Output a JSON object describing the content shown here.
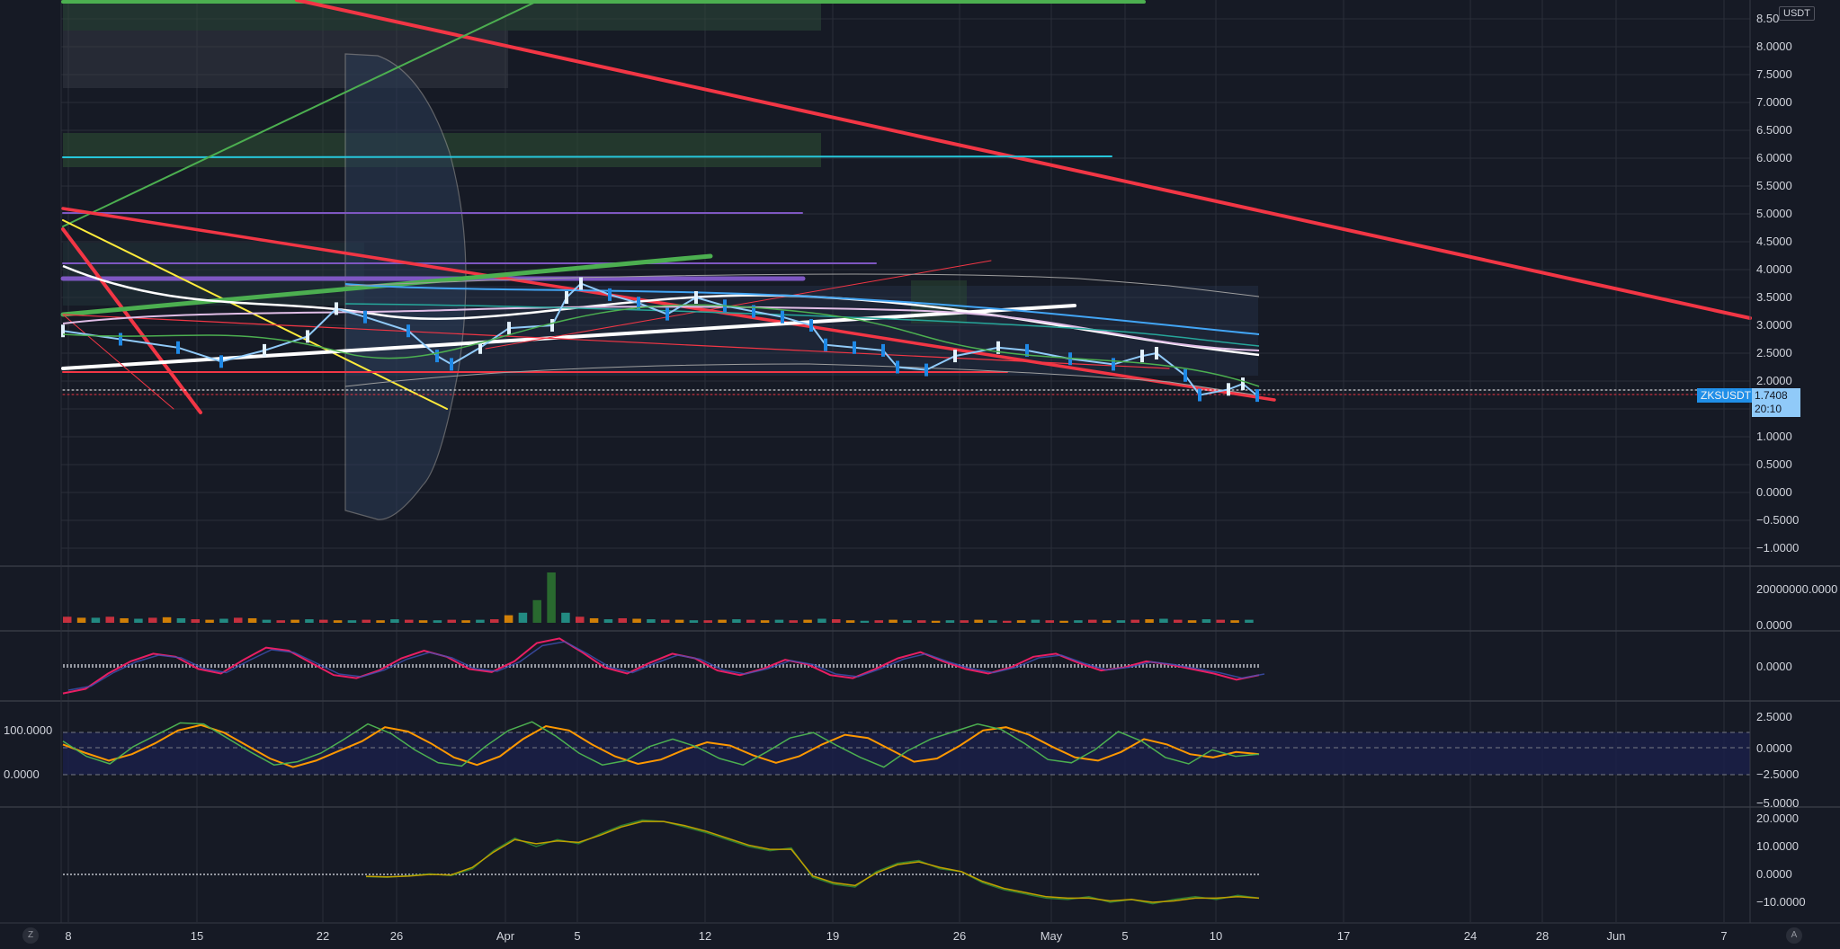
{
  "chart_data": {
    "type": "line",
    "symbol": "ZKSUSDT",
    "currency": "USDT",
    "last_price": "1.7408",
    "countdown": "20:10",
    "x_tick_labels": [
      "8",
      "15",
      "22",
      "26",
      "Apr",
      "5",
      "12",
      "19",
      "26",
      "May",
      "5",
      "10",
      "17",
      "24",
      "28",
      "Jun",
      "7"
    ],
    "price_axis": {
      "ticks": [
        "8.50",
        "8.0000",
        "7.5000",
        "7.0000",
        "6.5000",
        "6.0000",
        "5.5000",
        "5.0000",
        "4.5000",
        "4.0000",
        "3.5000",
        "3.0000",
        "2.5000",
        "2.0000",
        "1.5000",
        "1.0000",
        "0.5000",
        "0.0000",
        "−0.5000",
        "−1.0000"
      ],
      "ylim": [
        -1.0,
        8.5
      ]
    },
    "volume_axis": {
      "ticks": [
        "20000000.0000",
        "0.0000"
      ]
    },
    "oscillator1_axis": {
      "ticks": [
        "0.0000"
      ]
    },
    "oscillator2_axis": {
      "left_ticks": [
        "100.0000",
        "0.0000"
      ],
      "right_ticks": [
        "2.5000",
        "0.0000",
        "−2.5000",
        "−5.0000"
      ]
    },
    "oscillator3_axis": {
      "ticks": [
        "20.0000",
        "10.0000",
        "0.0000",
        "−10.0000"
      ]
    },
    "price_series": [
      {
        "x": 0,
        "y": 2.9
      },
      {
        "x": 4,
        "y": 2.75
      },
      {
        "x": 8,
        "y": 2.6
      },
      {
        "x": 11,
        "y": 2.35
      },
      {
        "x": 14,
        "y": 2.55
      },
      {
        "x": 17,
        "y": 2.8
      },
      {
        "x": 19,
        "y": 3.3
      },
      {
        "x": 21,
        "y": 3.15
      },
      {
        "x": 24,
        "y": 2.9
      },
      {
        "x": 26,
        "y": 2.45
      },
      {
        "x": 27,
        "y": 2.3
      },
      {
        "x": 29,
        "y": 2.6
      },
      {
        "x": 31,
        "y": 2.95
      },
      {
        "x": 34,
        "y": 3.0
      },
      {
        "x": 35,
        "y": 3.5
      },
      {
        "x": 36,
        "y": 3.75
      },
      {
        "x": 38,
        "y": 3.55
      },
      {
        "x": 40,
        "y": 3.4
      },
      {
        "x": 42,
        "y": 3.2
      },
      {
        "x": 44,
        "y": 3.5
      },
      {
        "x": 46,
        "y": 3.35
      },
      {
        "x": 48,
        "y": 3.25
      },
      {
        "x": 50,
        "y": 3.15
      },
      {
        "x": 52,
        "y": 3.0
      },
      {
        "x": 53,
        "y": 2.65
      },
      {
        "x": 55,
        "y": 2.6
      },
      {
        "x": 57,
        "y": 2.55
      },
      {
        "x": 58,
        "y": 2.25
      },
      {
        "x": 60,
        "y": 2.2
      },
      {
        "x": 62,
        "y": 2.45
      },
      {
        "x": 65,
        "y": 2.6
      },
      {
        "x": 67,
        "y": 2.55
      },
      {
        "x": 70,
        "y": 2.4
      },
      {
        "x": 73,
        "y": 2.3
      },
      {
        "x": 75,
        "y": 2.45
      },
      {
        "x": 76,
        "y": 2.5
      },
      {
        "x": 78,
        "y": 2.1
      },
      {
        "x": 79,
        "y": 1.75
      },
      {
        "x": 81,
        "y": 1.85
      },
      {
        "x": 82,
        "y": 1.95
      },
      {
        "x": 83,
        "y": 1.74
      }
    ],
    "volume_series": [
      0.12,
      0.1,
      0.1,
      0.12,
      0.09,
      0.08,
      0.1,
      0.11,
      0.09,
      0.07,
      0.06,
      0.08,
      0.1,
      0.09,
      0.06,
      0.05,
      0.06,
      0.07,
      0.06,
      0.05,
      0.05,
      0.06,
      0.05,
      0.07,
      0.06,
      0.05,
      0.05,
      0.06,
      0.05,
      0.06,
      0.07,
      0.15,
      0.2,
      0.45,
      1.0,
      0.2,
      0.12,
      0.09,
      0.07,
      0.09,
      0.08,
      0.07,
      0.06,
      0.06,
      0.05,
      0.05,
      0.06,
      0.07,
      0.06,
      0.05,
      0.06,
      0.05,
      0.06,
      0.08,
      0.07,
      0.05,
      0.04,
      0.05,
      0.06,
      0.05,
      0.05,
      0.04,
      0.05,
      0.05,
      0.06,
      0.05,
      0.04,
      0.05,
      0.06,
      0.05,
      0.04,
      0.05,
      0.06,
      0.05,
      0.05,
      0.06,
      0.07,
      0.08,
      0.06,
      0.05,
      0.07,
      0.06,
      0.05,
      0.06
    ],
    "series": [
      {
        "name": "",
        "color": "#e91e63",
        "values": [
          -1.8,
          -1.5,
          -0.5,
          0.3,
          0.8,
          0.6,
          -0.2,
          -0.5,
          0.4,
          1.2,
          1.0,
          0.2,
          -0.6,
          -0.8,
          -0.3,
          0.5,
          1.0,
          0.6,
          -0.2,
          -0.4,
          0.3,
          1.5,
          1.8,
          0.9,
          -0.1,
          -0.5,
          0.2,
          0.8,
          0.5,
          -0.3,
          -0.6,
          -0.2,
          0.4,
          0.1,
          -0.6,
          -0.8,
          -0.2,
          0.5,
          0.9,
          0.3,
          -0.2,
          -0.5,
          -0.1,
          0.6,
          0.8,
          0.2,
          -0.3,
          -0.1,
          0.3,
          0.1,
          -0.2,
          -0.5,
          -0.9,
          -0.6
        ]
      }
    ],
    "oscillator2_series": [
      {
        "name": "",
        "color": "#ff9800",
        "values": [
          0.3,
          -0.5,
          -1.2,
          -0.6,
          0.4,
          1.6,
          2.1,
          1.4,
          0.2,
          -1.0,
          -1.8,
          -1.2,
          -0.3,
          0.6,
          1.9,
          1.5,
          0.4,
          -0.9,
          -1.6,
          -0.8,
          0.8,
          2.0,
          1.6,
          0.3,
          -0.8,
          -1.5,
          -1.1,
          -0.2,
          0.5,
          0.2,
          -0.7,
          -1.4,
          -0.8,
          0.3,
          1.2,
          0.9,
          -0.2,
          -1.3,
          -1.0,
          0.2,
          1.6,
          1.9,
          1.2,
          0.1,
          -0.9,
          -1.2,
          -0.4,
          0.8,
          0.3,
          -0.6,
          -0.9,
          -0.4,
          -0.6
        ]
      },
      {
        "name": "",
        "color": "#4caf50",
        "values": [
          0.6,
          -0.8,
          -1.5,
          0.1,
          1.2,
          2.3,
          2.2,
          0.9,
          -0.4,
          -1.6,
          -1.3,
          -0.5,
          0.8,
          2.2,
          1.3,
          -0.2,
          -1.4,
          -1.7,
          0.1,
          1.6,
          2.4,
          1.1,
          -0.5,
          -1.6,
          -1.2,
          0.1,
          0.8,
          0.1,
          -1.0,
          -1.6,
          -0.4,
          0.9,
          1.4,
          0.2,
          -0.9,
          -1.8,
          -0.3,
          0.8,
          1.5,
          2.2,
          1.7,
          0.4,
          -1.1,
          -1.4,
          -0.2,
          1.5,
          0.6,
          -0.9,
          -1.5,
          -0.2,
          -0.8,
          -0.6
        ]
      }
    ],
    "oscillator3_series": [
      {
        "name": "",
        "color": "#2e7d32",
        "values": [
          -0.8,
          -1.0,
          -0.5,
          0.2,
          -0.4,
          2.0,
          8.5,
          13.0,
          10.0,
          12.5,
          11.0,
          14.5,
          17.5,
          19.5,
          19.0,
          17.0,
          15.0,
          12.5,
          10.0,
          8.5,
          9.5,
          -1.0,
          -3.5,
          -4.5,
          1.0,
          4.0,
          5.0,
          2.0,
          1.0,
          -3.0,
          -5.5,
          -7.0,
          -8.5,
          -9.0,
          -8.0,
          -10.0,
          -9.0,
          -10.5,
          -9.0,
          -8.0,
          -9.0,
          -7.5,
          -8.5
        ]
      },
      {
        "name": "",
        "color": "#c0a000",
        "values": [
          -0.7,
          -0.9,
          -0.6,
          0.0,
          -0.2,
          2.5,
          8.0,
          12.5,
          11.0,
          12.0,
          11.5,
          14.0,
          17.0,
          19.0,
          19.0,
          17.5,
          15.5,
          13.0,
          10.5,
          9.0,
          9.0,
          -0.5,
          -3.0,
          -4.0,
          0.5,
          3.5,
          4.5,
          2.5,
          1.0,
          -2.5,
          -5.0,
          -6.5,
          -8.0,
          -8.5,
          -8.5,
          -9.5,
          -9.0,
          -10.0,
          -9.5,
          -8.5,
          -8.5,
          -8.0,
          -8.5
        ]
      }
    ],
    "colors": {
      "background": "#161a25",
      "grid": "#2a2e39",
      "trendline_red": "#f23645",
      "trendline_white": "#ffffff",
      "trendline_green": "#4caf50",
      "trendline_yellow": "#ffeb3b",
      "level_cyan": "#26c6da",
      "level_purple": "#7e57c2",
      "ma_blue": "#42a5f5",
      "price_tag": "#90caf9"
    }
  },
  "controls": {
    "left_corner": "Z",
    "right_corner": "A"
  }
}
